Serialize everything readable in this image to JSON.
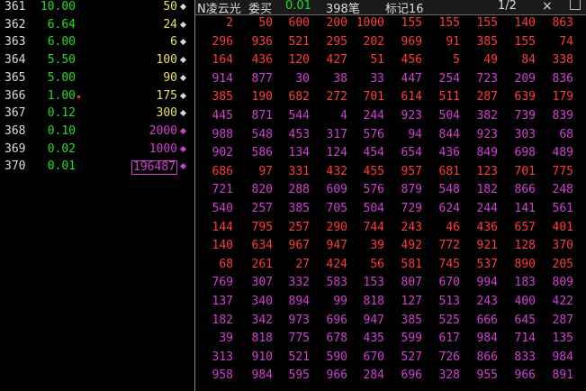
{
  "colors": {
    "red": "#ff3b3b",
    "purple": "#d040d0",
    "green": "#22dd22",
    "yellow": "#e8e060"
  },
  "left_list": [
    {
      "idx": "361",
      "price": "10.00",
      "volume": "50",
      "vol_color": "yellow",
      "flag": false,
      "boxed": false
    },
    {
      "idx": "362",
      "price": "6.64",
      "volume": "24",
      "vol_color": "yellow",
      "flag": false,
      "boxed": false
    },
    {
      "idx": "363",
      "price": "6.00",
      "volume": "6",
      "vol_color": "yellow",
      "flag": false,
      "boxed": false
    },
    {
      "idx": "364",
      "price": "5.50",
      "volume": "100",
      "vol_color": "yellow",
      "flag": false,
      "boxed": false
    },
    {
      "idx": "365",
      "price": "5.00",
      "volume": "90",
      "vol_color": "yellow",
      "flag": false,
      "boxed": false
    },
    {
      "idx": "366",
      "price": "1.00",
      "volume": "175",
      "vol_color": "yellow",
      "flag": true,
      "boxed": false
    },
    {
      "idx": "367",
      "price": "0.12",
      "volume": "300",
      "vol_color": "yellow",
      "flag": false,
      "boxed": false
    },
    {
      "idx": "368",
      "price": "0.10",
      "volume": "2000",
      "vol_color": "purple",
      "flag": false,
      "boxed": false
    },
    {
      "idx": "369",
      "price": "0.02",
      "volume": "1000",
      "vol_color": "purple",
      "flag": false,
      "boxed": false
    },
    {
      "idx": "370",
      "price": "0.01",
      "volume": "196487",
      "vol_color": "purple",
      "flag": false,
      "boxed": true
    }
  ],
  "header": {
    "stock": "N凌云光",
    "side": "委买",
    "price": "0.01",
    "count": "398笔",
    "mark_label": "标记16",
    "page": "1/2",
    "close": "×"
  },
  "grid_rows": [
    {
      "c": "r",
      "v": [
        "2",
        "50",
        "600",
        "200",
        "1000",
        "155",
        "155",
        "155",
        "140",
        "863"
      ]
    },
    {
      "c": "r",
      "v": [
        "296",
        "936",
        "521",
        "295",
        "202",
        "969",
        "91",
        "385",
        "155",
        "74"
      ]
    },
    {
      "c": "r",
      "v": [
        "164",
        "436",
        "120",
        "427",
        "51",
        "456",
        "5",
        "49",
        "84",
        "338"
      ]
    },
    {
      "c": "p",
      "v": [
        "914",
        "877",
        "30",
        "38",
        "33",
        "447",
        "254",
        "723",
        "209",
        "836"
      ]
    },
    {
      "c": "r",
      "v": [
        "385",
        "190",
        "682",
        "272",
        "701",
        "614",
        "511",
        "287",
        "639",
        "179"
      ]
    },
    {
      "c": "p",
      "v": [
        "445",
        "871",
        "544",
        "4",
        "244",
        "923",
        "504",
        "382",
        "739",
        "839"
      ]
    },
    {
      "c": "p",
      "v": [
        "988",
        "548",
        "453",
        "317",
        "576",
        "94",
        "844",
        "923",
        "303",
        "68"
      ]
    },
    {
      "c": "p",
      "v": [
        "902",
        "586",
        "134",
        "124",
        "454",
        "654",
        "436",
        "849",
        "698",
        "489"
      ]
    },
    {
      "c": "r",
      "v": [
        "686",
        "97",
        "331",
        "432",
        "455",
        "957",
        "681",
        "123",
        "701",
        "775"
      ]
    },
    {
      "c": "p",
      "v": [
        "721",
        "820",
        "288",
        "609",
        "576",
        "879",
        "548",
        "182",
        "866",
        "248"
      ]
    },
    {
      "c": "p",
      "v": [
        "540",
        "257",
        "385",
        "705",
        "504",
        "729",
        "624",
        "244",
        "141",
        "561"
      ]
    },
    {
      "c": "r",
      "v": [
        "144",
        "795",
        "257",
        "290",
        "744",
        "243",
        "46",
        "436",
        "657",
        "401"
      ]
    },
    {
      "c": "r",
      "v": [
        "140",
        "634",
        "967",
        "947",
        "39",
        "492",
        "772",
        "921",
        "128",
        "370"
      ]
    },
    {
      "c": "r",
      "v": [
        "68",
        "261",
        "27",
        "424",
        "56",
        "581",
        "745",
        "537",
        "890",
        "205"
      ]
    },
    {
      "c": "p",
      "v": [
        "769",
        "307",
        "332",
        "583",
        "153",
        "807",
        "670",
        "994",
        "183",
        "809"
      ]
    },
    {
      "c": "p",
      "v": [
        "137",
        "340",
        "894",
        "99",
        "818",
        "127",
        "513",
        "243",
        "400",
        "422"
      ]
    },
    {
      "c": "p",
      "v": [
        "182",
        "342",
        "973",
        "696",
        "947",
        "385",
        "525",
        "666",
        "645",
        "287"
      ]
    },
    {
      "c": "p",
      "v": [
        "39",
        "818",
        "775",
        "678",
        "435",
        "599",
        "617",
        "984",
        "714",
        "135"
      ]
    },
    {
      "c": "p",
      "v": [
        "313",
        "910",
        "521",
        "590",
        "670",
        "527",
        "726",
        "866",
        "833",
        "984"
      ]
    },
    {
      "c": "p",
      "v": [
        "958",
        "984",
        "595",
        "966",
        "284",
        "696",
        "328",
        "955",
        "966",
        "891"
      ]
    }
  ]
}
